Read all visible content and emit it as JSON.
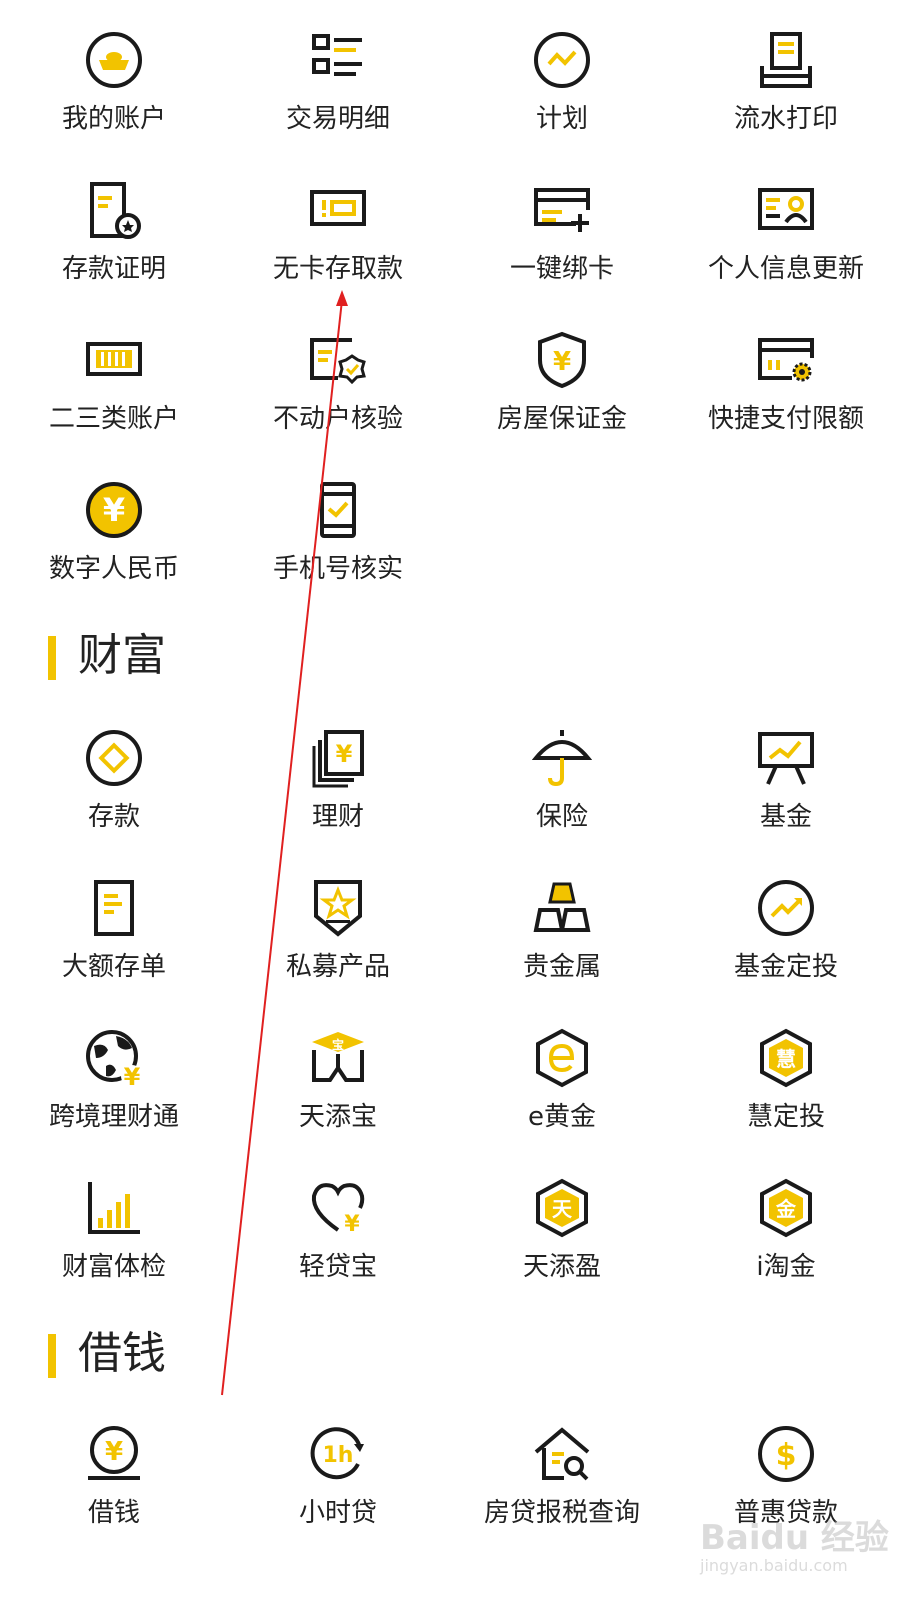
{
  "colors": {
    "accent": "#f2c300",
    "ink": "#1a1a1a",
    "arrow": "#e02020"
  },
  "grid_account": [
    {
      "label": "我的账户",
      "icon": "gold-ingot-icon"
    },
    {
      "label": "交易明细",
      "icon": "list-icon"
    },
    {
      "label": "计划",
      "icon": "trend-circle-icon"
    },
    {
      "label": "流水打印",
      "icon": "printer-icon"
    },
    {
      "label": "存款证明",
      "icon": "certificate-icon"
    },
    {
      "label": "无卡存取款",
      "icon": "cardless-icon"
    },
    {
      "label": "一键绑卡",
      "icon": "add-card-icon"
    },
    {
      "label": "个人信息更新",
      "icon": "id-card-icon"
    },
    {
      "label": "二三类账户",
      "icon": "account-class-icon"
    },
    {
      "label": "不动户核验",
      "icon": "verify-badge-icon"
    },
    {
      "label": "房屋保证金",
      "icon": "shield-yen-icon"
    },
    {
      "label": "快捷支付限额",
      "icon": "card-gear-icon"
    },
    {
      "label": "数字人民币",
      "icon": "digital-yen-icon"
    },
    {
      "label": "手机号核实",
      "icon": "phone-check-icon"
    }
  ],
  "section_wealth": {
    "title": "财富"
  },
  "grid_wealth": [
    {
      "label": "存款",
      "icon": "deposit-icon"
    },
    {
      "label": "理财",
      "icon": "finance-yen-icon"
    },
    {
      "label": "保险",
      "icon": "umbrella-icon"
    },
    {
      "label": "基金",
      "icon": "fund-chart-icon"
    },
    {
      "label": "大额存单",
      "icon": "document-icon"
    },
    {
      "label": "私募产品",
      "icon": "star-shield-icon"
    },
    {
      "label": "贵金属",
      "icon": "gold-bars-icon"
    },
    {
      "label": "基金定投",
      "icon": "trend-up-circle-icon"
    },
    {
      "label": "跨境理财通",
      "icon": "globe-yen-icon"
    },
    {
      "label": "天添宝",
      "icon": "box-bao-icon"
    },
    {
      "label": "e黄金",
      "icon": "hex-e-icon"
    },
    {
      "label": "慧定投",
      "icon": "hex-hui-icon"
    },
    {
      "label": "财富体检",
      "icon": "bar-chart-icon"
    },
    {
      "label": "轻贷宝",
      "icon": "heart-yen-icon"
    },
    {
      "label": "天添盈",
      "icon": "hex-tian-icon"
    },
    {
      "label": "i淘金",
      "icon": "hex-jin-icon"
    }
  ],
  "section_borrow": {
    "title": "借钱"
  },
  "grid_borrow": [
    {
      "label": "借钱",
      "icon": "coin-yen-icon"
    },
    {
      "label": "小时贷",
      "icon": "hour-clock-icon"
    },
    {
      "label": "房贷报税查询",
      "icon": "house-search-icon"
    },
    {
      "label": "普惠贷款",
      "icon": "dollar-circle-icon"
    }
  ],
  "watermark": {
    "brand": "Baidu 经验",
    "sub": "jingyan.baidu.com"
  }
}
